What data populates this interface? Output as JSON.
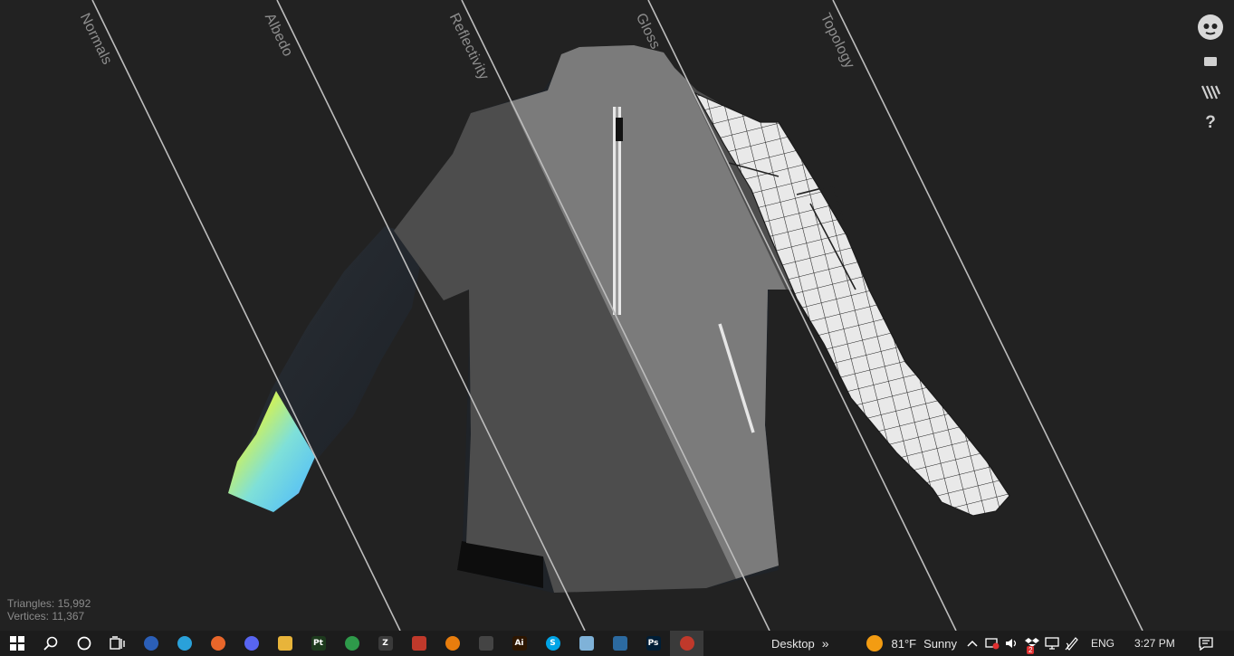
{
  "viewer": {
    "channels": [
      "Normals",
      "Albedo",
      "Reflectivity",
      "Gloss",
      "Topology"
    ],
    "stats": {
      "triangles": "Triangles: 15,992",
      "vertices": "Vertices: 11,367"
    },
    "tools": {
      "help": "?"
    }
  },
  "taskbar": {
    "apps": [
      {
        "name": "vivaldi-icon",
        "label": "",
        "color": "#2b5fb8"
      },
      {
        "name": "telegram-icon",
        "label": "",
        "color": "#2aa1da"
      },
      {
        "name": "firefox-icon",
        "label": "",
        "color": "#e8662a"
      },
      {
        "name": "discord-icon",
        "label": "",
        "color": "#5865f2"
      },
      {
        "name": "file-explorer-icon",
        "label": "",
        "color": "#e8b43a"
      },
      {
        "name": "pt-app-icon",
        "label": "Pt",
        "color": "#1d3a1d"
      },
      {
        "name": "chrome-icon",
        "label": "",
        "color": "#2e9a4a"
      },
      {
        "name": "zbrush-icon",
        "label": "Z",
        "color": "#3a3a3a"
      },
      {
        "name": "shield-app-icon",
        "label": "",
        "color": "#c0392b"
      },
      {
        "name": "blender-icon",
        "label": "",
        "color": "#e87d0d"
      },
      {
        "name": "dots-app-icon",
        "label": "",
        "color": "#444444"
      },
      {
        "name": "illustrator-icon",
        "label": "Ai",
        "color": "#2d1600"
      },
      {
        "name": "skype-icon",
        "label": "S",
        "color": "#00a4e6"
      },
      {
        "name": "notepad-icon",
        "label": "",
        "color": "#7fb2d8"
      },
      {
        "name": "feather-app-icon",
        "label": "",
        "color": "#2c6aa0"
      },
      {
        "name": "photoshop-icon",
        "label": "Ps",
        "color": "#001e36"
      },
      {
        "name": "marmoset-icon",
        "label": "",
        "color": "#c0392b"
      }
    ],
    "desktop_label": "Desktop",
    "chevron": "»",
    "weather": {
      "temp": "81°F",
      "condition": "Sunny"
    },
    "tray_badge": "2",
    "language": "ENG",
    "time": "3:27 PM"
  }
}
